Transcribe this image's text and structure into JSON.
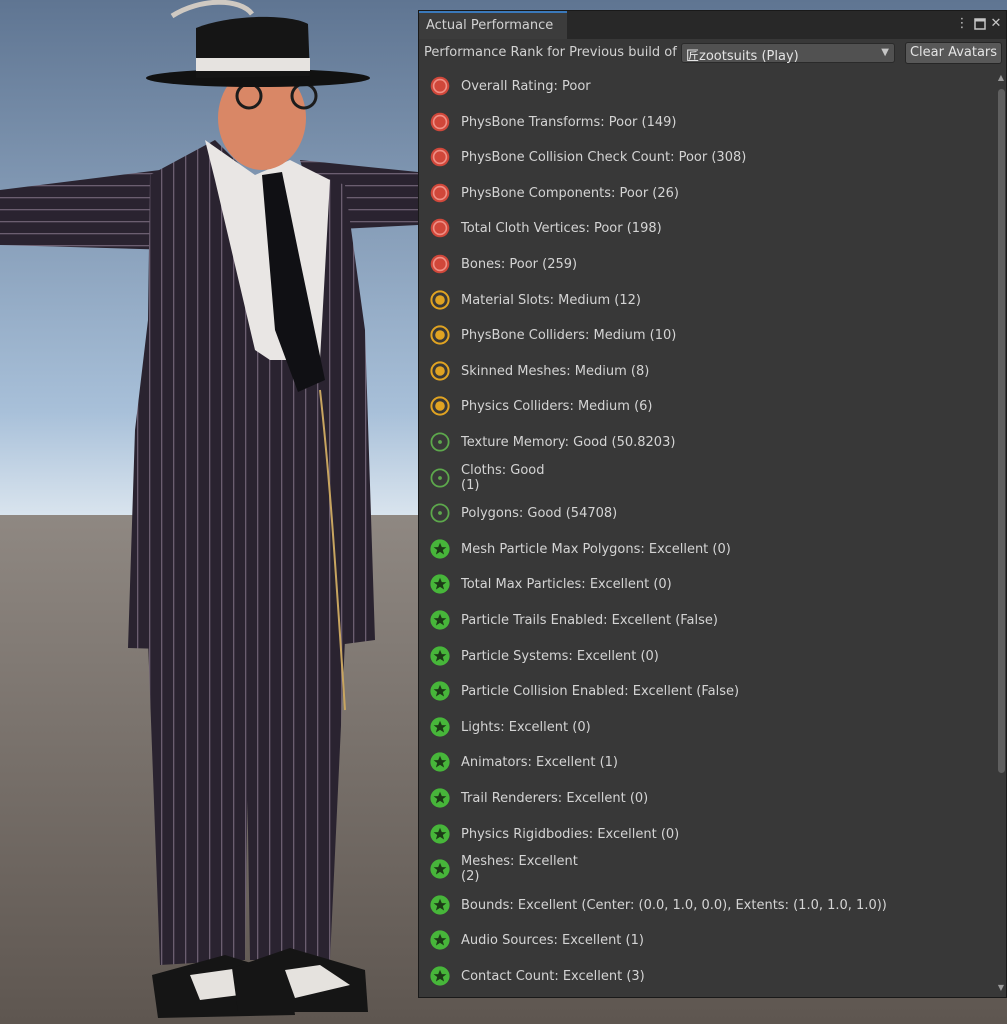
{
  "window": {
    "tab_title": "Actual Performance",
    "menu_icon": "kebab-menu-icon",
    "maximize_icon": "maximize-icon",
    "close_icon": "close-icon"
  },
  "toolbar": {
    "rank_label": "Performance Rank for Previous build of",
    "build_value": "匠zootsuits (Play)",
    "clear_label": "Clear Avatars"
  },
  "colors": {
    "poor": "#d0473a",
    "medium": "#e0a322",
    "good": "#5da84c",
    "excellent": "#47b63a",
    "panel_bg": "#383838",
    "tab_accent": "#3a79bb"
  },
  "items": [
    {
      "rating": "poor",
      "icon": "poor-rating-icon",
      "text": "Overall Rating: Poor"
    },
    {
      "rating": "poor",
      "icon": "poor-rating-icon",
      "text": "PhysBone Transforms: Poor (149)"
    },
    {
      "rating": "poor",
      "icon": "poor-rating-icon",
      "text": "PhysBone Collision Check Count: Poor (308)"
    },
    {
      "rating": "poor",
      "icon": "poor-rating-icon",
      "text": "PhysBone Components: Poor (26)"
    },
    {
      "rating": "poor",
      "icon": "poor-rating-icon",
      "text": "Total Cloth Vertices: Poor (198)"
    },
    {
      "rating": "poor",
      "icon": "poor-rating-icon",
      "text": "Bones: Poor (259)"
    },
    {
      "rating": "medium",
      "icon": "medium-rating-icon",
      "text": "Material Slots: Medium (12)"
    },
    {
      "rating": "medium",
      "icon": "medium-rating-icon",
      "text": "PhysBone Colliders: Medium (10)"
    },
    {
      "rating": "medium",
      "icon": "medium-rating-icon",
      "text": "Skinned Meshes: Medium (8)"
    },
    {
      "rating": "medium",
      "icon": "medium-rating-icon",
      "text": "Physics Colliders: Medium (6)"
    },
    {
      "rating": "good",
      "icon": "good-rating-icon",
      "text": "Texture Memory: Good (50.8203)"
    },
    {
      "rating": "good",
      "icon": "good-rating-icon",
      "text": "Cloths: Good\n(1)"
    },
    {
      "rating": "good",
      "icon": "good-rating-icon",
      "text": "Polygons: Good (54708)"
    },
    {
      "rating": "excellent",
      "icon": "excellent-star-icon",
      "text": "Mesh Particle Max Polygons: Excellent (0)"
    },
    {
      "rating": "excellent",
      "icon": "excellent-star-icon",
      "text": "Total Max Particles: Excellent (0)"
    },
    {
      "rating": "excellent",
      "icon": "excellent-star-icon",
      "text": "Particle Trails Enabled: Excellent (False)"
    },
    {
      "rating": "excellent",
      "icon": "excellent-star-icon",
      "text": "Particle Systems: Excellent (0)"
    },
    {
      "rating": "excellent",
      "icon": "excellent-star-icon",
      "text": "Particle Collision Enabled: Excellent (False)"
    },
    {
      "rating": "excellent",
      "icon": "excellent-star-icon",
      "text": "Lights: Excellent (0)"
    },
    {
      "rating": "excellent",
      "icon": "excellent-star-icon",
      "text": "Animators: Excellent (1)"
    },
    {
      "rating": "excellent",
      "icon": "excellent-star-icon",
      "text": "Trail Renderers: Excellent (0)"
    },
    {
      "rating": "excellent",
      "icon": "excellent-star-icon",
      "text": "Physics Rigidbodies: Excellent (0)"
    },
    {
      "rating": "excellent",
      "icon": "excellent-star-icon",
      "text": "Meshes: Excellent\n(2)"
    },
    {
      "rating": "excellent",
      "icon": "excellent-star-icon",
      "text": "Bounds: Excellent (Center: (0.0, 1.0, 0.0), Extents: (1.0, 1.0, 1.0))"
    },
    {
      "rating": "excellent",
      "icon": "excellent-star-icon",
      "text": "Audio Sources: Excellent (1)"
    },
    {
      "rating": "excellent",
      "icon": "excellent-star-icon",
      "text": "Contact Count: Excellent (3)"
    }
  ]
}
